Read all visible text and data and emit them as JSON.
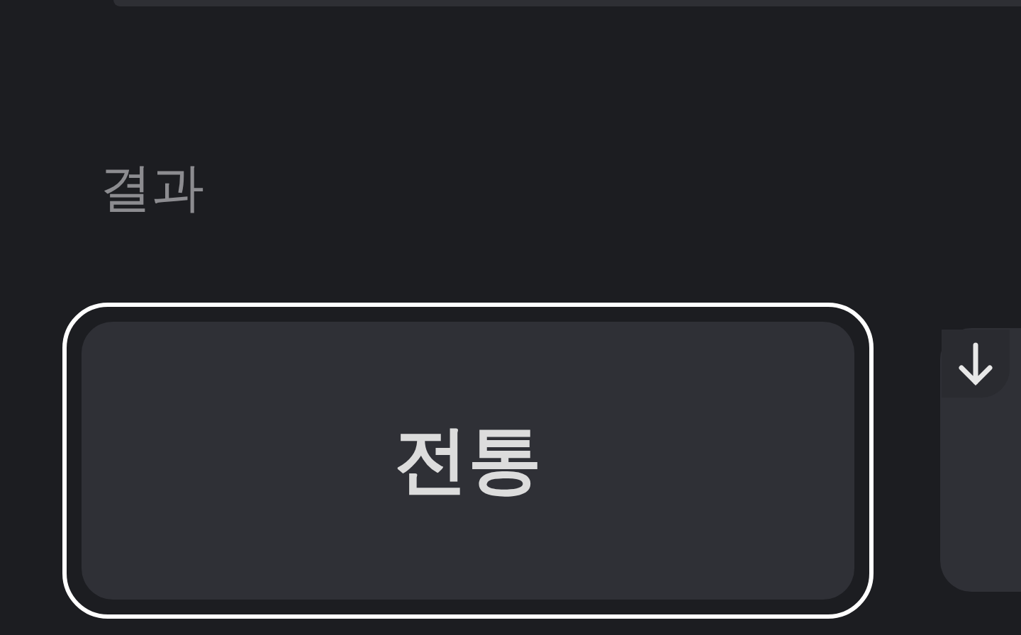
{
  "section_label": "결과",
  "cards": [
    {
      "label": "전통",
      "selected": true
    },
    {
      "selected": false
    }
  ]
}
